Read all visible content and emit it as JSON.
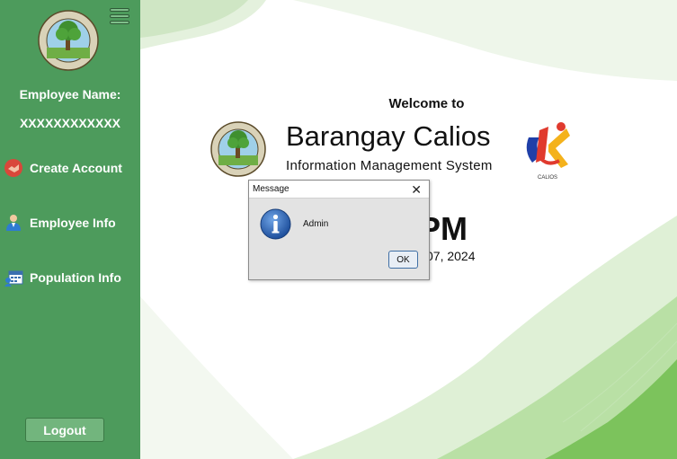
{
  "sidebar": {
    "employee_label": "Employee Name:",
    "employee_value": "XXXXXXXXXXXX",
    "menu_icon": "hamburger-menu-icon",
    "items": [
      {
        "label": "Create Account",
        "icon": "create-account-icon"
      },
      {
        "label": "Employee Info",
        "icon": "employee-icon"
      },
      {
        "label": "Population Info",
        "icon": "population-icon"
      }
    ],
    "logout_label": "Logout",
    "colors": {
      "background": "#4d9b5c",
      "logout_button": "#72b57d"
    }
  },
  "main": {
    "welcome": "Welcome to",
    "title": "Barangay Calios",
    "subtitle": "Information Management System",
    "time_fragment": "PM",
    "date_fragment": "07, 2024",
    "brand_logo_text": "CALIOS",
    "seal_text": "BARANGAY CALIOS · STA.CRUZ, LAGUNA"
  },
  "dialog": {
    "title": "Message",
    "close_label": "✕",
    "message": "Admin",
    "ok_label": "OK",
    "icon": "information-icon"
  }
}
